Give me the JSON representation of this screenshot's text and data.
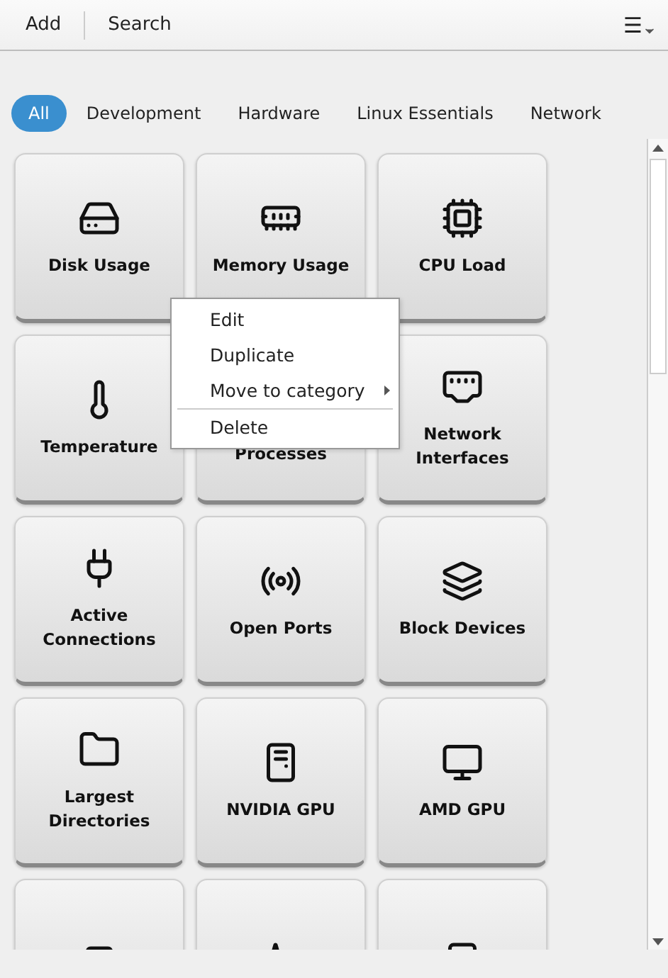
{
  "toolbar": {
    "buttons": [
      "Add",
      "Search"
    ],
    "menu_icon": "☰"
  },
  "tabs": [
    {
      "label": "All",
      "selected": true
    },
    {
      "label": "Development",
      "selected": false
    },
    {
      "label": "Hardware",
      "selected": false
    },
    {
      "label": "Linux Essentials",
      "selected": false
    },
    {
      "label": "Network",
      "selected": false
    }
  ],
  "tiles": [
    {
      "kind": "disk",
      "label": "Disk Usage"
    },
    {
      "kind": "memory",
      "label": "Memory Usage"
    },
    {
      "kind": "cpu",
      "label": "CPU Load"
    },
    {
      "kind": "thermometer",
      "label": "Temperature"
    },
    {
      "kind": "covered",
      "label": "Processes"
    },
    {
      "kind": "ethernet",
      "label": "Network Interfaces"
    },
    {
      "kind": "plug",
      "label": "Active Connections"
    },
    {
      "kind": "broadcast",
      "label": "Open Ports"
    },
    {
      "kind": "layers",
      "label": "Block Devices"
    },
    {
      "kind": "folder",
      "label": "Largest Directories"
    },
    {
      "kind": "workstation",
      "label": "NVIDIA GPU"
    },
    {
      "kind": "desktop",
      "label": "AMD GPU"
    },
    {
      "kind": "disk"
    },
    {
      "kind": "activity"
    },
    {
      "kind": "workstation"
    }
  ],
  "context_menu": [
    {
      "label": "Edit",
      "kind": "item"
    },
    {
      "label": "Duplicate",
      "kind": "item"
    },
    {
      "label": "Move to category",
      "kind": "submenu"
    },
    {
      "kind": "separator"
    },
    {
      "label": "Delete",
      "kind": "item"
    }
  ]
}
